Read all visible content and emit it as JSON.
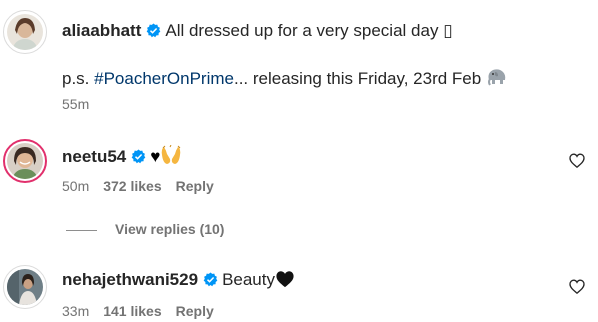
{
  "caption": {
    "username": "aliaabhatt",
    "text": "All dressed up for a very special day",
    "text_trailing_glyph": "▯",
    "ps_prefix": "p.s. ",
    "hashtag": "#PoacherOnPrime",
    "ps_suffix": "... releasing this Friday, 23rd Feb",
    "time": "55m"
  },
  "comments": [
    {
      "username": "neetu54",
      "text_emoji": "♥",
      "time": "50m",
      "likes": "372 likes",
      "reply_label": "Reply"
    },
    {
      "username": "nehajethwani529",
      "text": "Beauty",
      "time": "33m",
      "likes": "141 likes",
      "reply_label": "Reply"
    }
  ],
  "view_replies": "View replies (10)",
  "colors": {
    "verified": "#0095f6",
    "hashtag": "#00376b",
    "meta": "#737373",
    "text": "#262626"
  },
  "icons": {
    "verified": "verified-badge-icon",
    "like": "heart-outline-icon",
    "elephant": "elephant-emoji",
    "hands": "raised-hands-emoji",
    "black_heart": "black-heart-emoji"
  }
}
